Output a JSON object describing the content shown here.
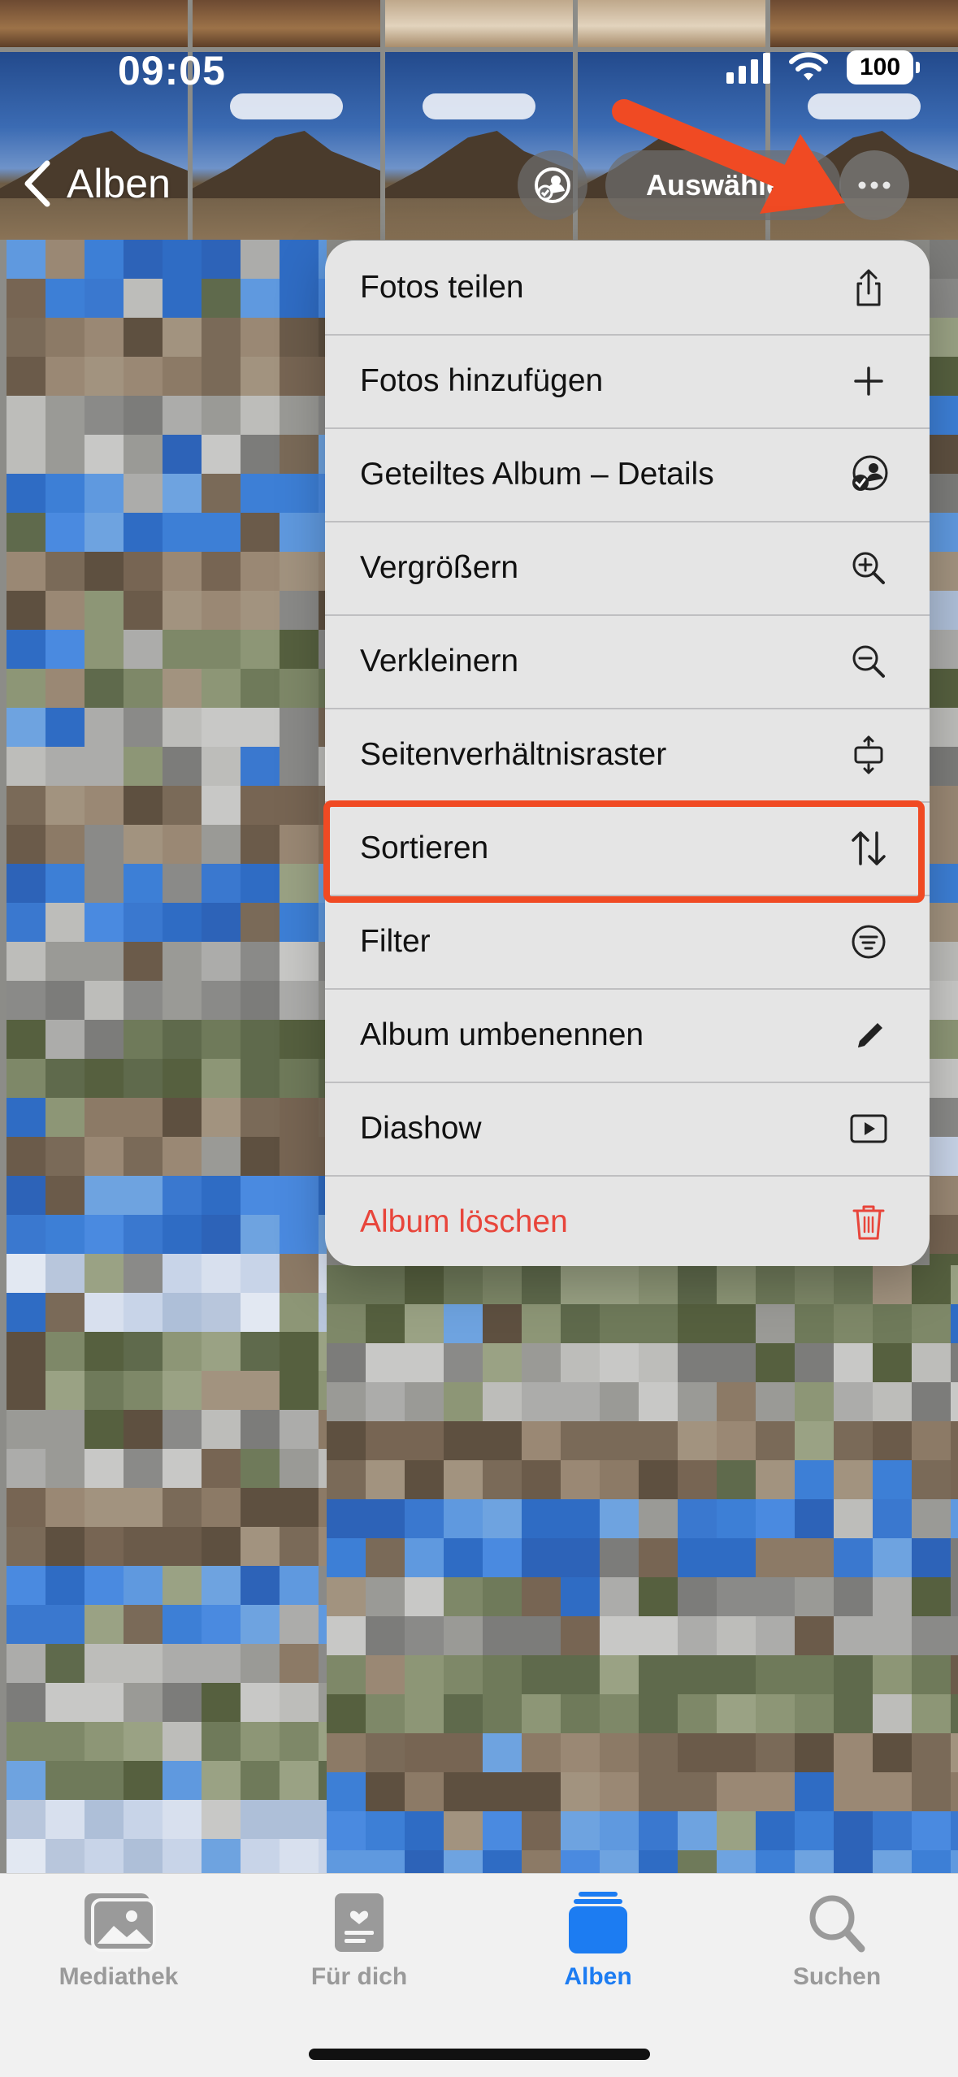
{
  "status_bar": {
    "time": "09:05",
    "battery": "100",
    "icons": [
      "signal-icon",
      "wifi-icon",
      "battery-icon"
    ]
  },
  "nav": {
    "back_label": "Alben",
    "select_label": "Auswählen",
    "icons": [
      "chevron-left-icon",
      "shared-album-icon",
      "ellipsis-icon"
    ]
  },
  "menu": {
    "items": [
      {
        "label": "Fotos teilen",
        "icon": "share-icon"
      },
      {
        "label": "Fotos hinzufügen",
        "icon": "plus-icon"
      },
      {
        "label": "Geteiltes Album – Details",
        "icon": "shared-album-icon"
      },
      {
        "label": "Vergrößern",
        "icon": "zoom-in-icon"
      },
      {
        "label": "Verkleinern",
        "icon": "zoom-out-icon"
      },
      {
        "label": "Seitenverhältnisraster",
        "icon": "aspect-ratio-icon"
      },
      {
        "label": "Sortieren",
        "icon": "sort-icon",
        "highlighted": true
      },
      {
        "label": "Filter",
        "icon": "filter-icon"
      },
      {
        "label": "Album umbenennen",
        "icon": "pencil-icon"
      },
      {
        "label": "Diashow",
        "icon": "play-icon"
      },
      {
        "label": "Album löschen",
        "icon": "trash-icon",
        "destructive": true
      }
    ]
  },
  "tab_bar": {
    "tabs": [
      {
        "label": "Mediathek",
        "icon": "photo-library-icon",
        "active": false
      },
      {
        "label": "Für dich",
        "icon": "for-you-icon",
        "active": false
      },
      {
        "label": "Alben",
        "icon": "albums-icon",
        "active": true
      },
      {
        "label": "Suchen",
        "icon": "search-icon",
        "active": false
      }
    ]
  },
  "colors": {
    "accent": "#1c7cf2",
    "destructive": "#e8453b",
    "annotation": "#f04a23"
  }
}
